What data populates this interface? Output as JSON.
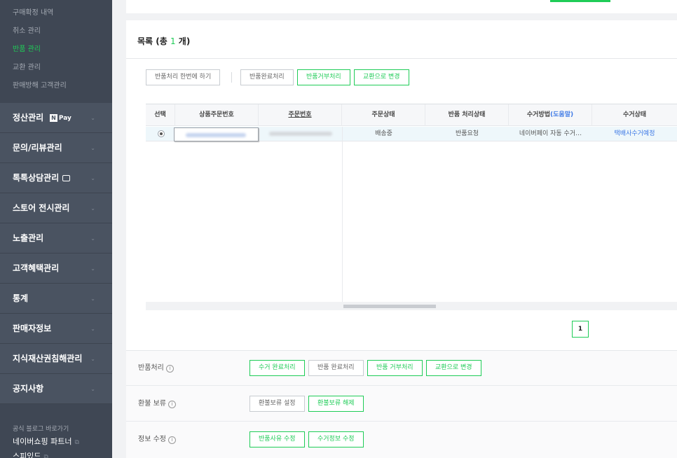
{
  "sidebar": {
    "sub_items": [
      {
        "label": "구매확정 내역",
        "active": false
      },
      {
        "label": "취소 관리",
        "active": false
      },
      {
        "label": "반품 관리",
        "active": true
      },
      {
        "label": "교환 관리",
        "active": false
      },
      {
        "label": "판매방해 고객관리",
        "active": false
      }
    ],
    "menu": [
      {
        "label": "정산관리",
        "badge": "Pay",
        "badge_n": "N"
      },
      {
        "label": "문의/리뷰관리"
      },
      {
        "label": "톡톡상담관리"
      },
      {
        "label": "스토어 전시관리"
      },
      {
        "label": "노출관리"
      },
      {
        "label": "고객혜택관리"
      },
      {
        "label": "통계"
      },
      {
        "label": "판매자정보"
      },
      {
        "label": "지식재산권침해관리"
      },
      {
        "label": "공지사항"
      }
    ],
    "footer": {
      "blog_link": "공식 블로그 바로가기",
      "partner": "네이버쇼핑 파트너",
      "partner2": "스피있드"
    },
    "chevron": "⌄"
  },
  "list": {
    "title_prefix": "목록 (총 ",
    "count": "1",
    "title_suffix": " 개)"
  },
  "toolbar": {
    "batch_label": "반품처리 한번에 하기",
    "complete_label": "반품완료처리",
    "reject_label": "반품거부처리",
    "exchange_label": "교환으로 변경"
  },
  "table": {
    "headers": {
      "select": "선택",
      "product_order_no": "상품주문번호",
      "order_no": "주문번호",
      "order_status": "주문상태",
      "return_status": "반품 처리상태",
      "pickup_method": "수거방법",
      "pickup_help": "(도움말)",
      "pickup_status": "수거상태"
    },
    "row": {
      "order_status": "배송중",
      "return_status": "반품요청",
      "pickup_method": "네이버페이 자동 수거…",
      "pickup_status": "택배사수거예정"
    }
  },
  "pagination": {
    "current": "1"
  },
  "actions": {
    "return_label": "반품처리",
    "hold_label": "환불 보류",
    "edit_label": "정보 수정",
    "info_glyph": "i",
    "return_buttons": {
      "pickup_done": "수거 완료처리",
      "return_done": "반품 완료처리",
      "return_reject": "반품 거부처리",
      "to_exchange": "교환으로 변경"
    },
    "hold_buttons": {
      "set": "환불보류 설정",
      "release": "환불보류 해제"
    },
    "edit_buttons": {
      "reason": "반품사유 수정",
      "pickup_info": "수거정보 수정"
    }
  },
  "colors": {
    "accent": "#1fcc57",
    "sidebar_bg": "#4a5361",
    "link": "#3f7ae6"
  }
}
